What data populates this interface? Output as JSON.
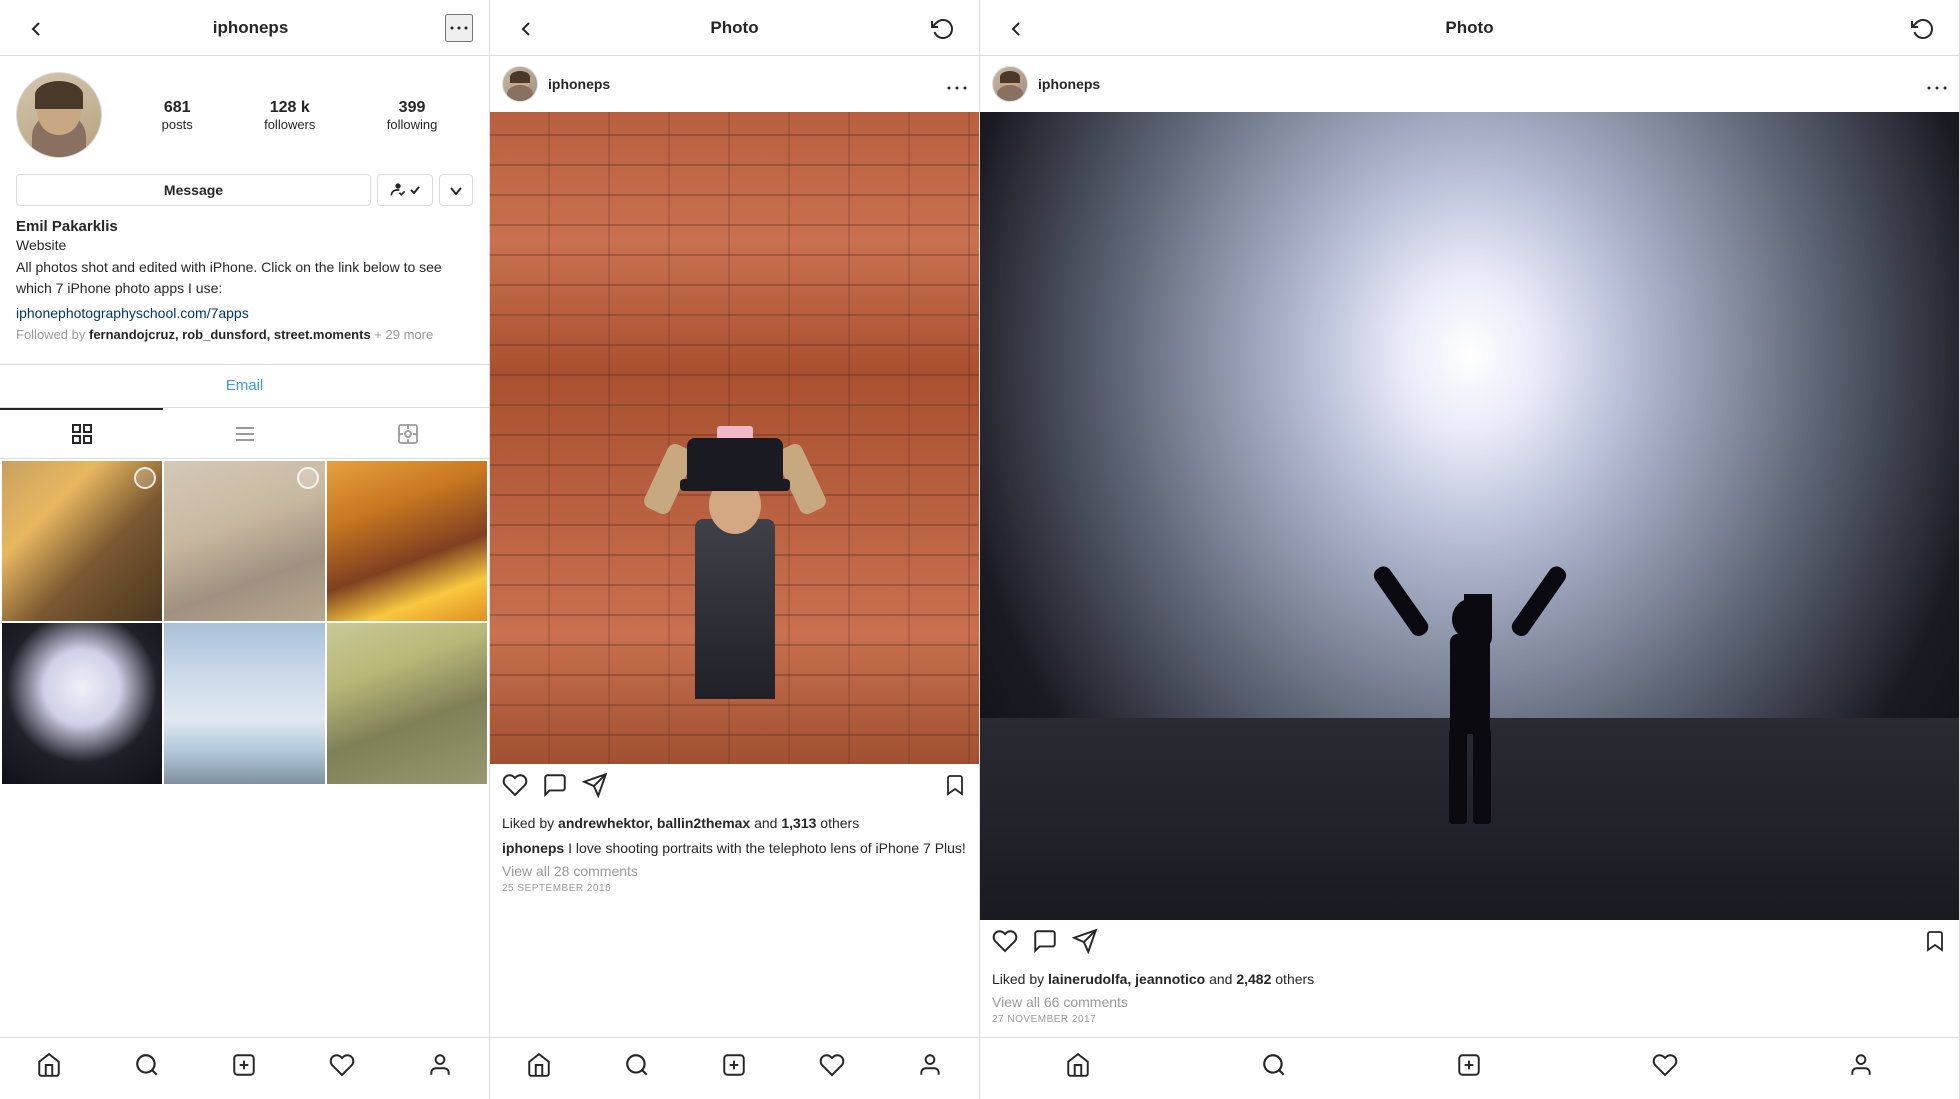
{
  "colors": {
    "accent": "#3897f0",
    "link": "#003569",
    "border": "#dbdbdb",
    "text_primary": "#262626",
    "text_secondary": "#999",
    "bg": "#fff"
  },
  "panel1": {
    "header": {
      "back_icon": "←",
      "title": "iphoneps",
      "more_icon": "···"
    },
    "profile": {
      "stats": {
        "posts_count": "681",
        "posts_label": "posts",
        "followers_count": "128 k",
        "followers_label": "followers",
        "following_count": "399",
        "following_label": "following"
      },
      "actions": {
        "message_label": "Message",
        "follow_check_icon": "✓",
        "dropdown_icon": "▾"
      },
      "name": "Emil Pakarklis",
      "website": "Website",
      "bio": "All photos shot and edited with iPhone. Click on the link below to see which 7 iPhone photo apps I use:",
      "link": "iphonephotographyschool.com/7apps",
      "followed_by_prefix": "Followed by ",
      "followed_by_users": "fernandojcruz, rob_dunsford, street.moments",
      "followed_by_suffix": " + 29 more",
      "email_label": "Email"
    },
    "tabs": {
      "grid_label": "Grid",
      "list_label": "List",
      "tagged_label": "Tagged"
    },
    "grid_photos": [
      {
        "id": 1,
        "class": "photo-1"
      },
      {
        "id": 2,
        "class": "photo-2"
      },
      {
        "id": 3,
        "class": "photo-3"
      },
      {
        "id": 4,
        "class": "photo-4"
      },
      {
        "id": 5,
        "class": "photo-5"
      },
      {
        "id": 6,
        "class": "photo-6"
      }
    ]
  },
  "panel2": {
    "header": {
      "back_icon": "←",
      "title": "Photo",
      "refresh_icon": "↺"
    },
    "post": {
      "username": "iphoneps",
      "more_icon": "···",
      "likes_text_before": "Liked by ",
      "likes_users": "andrewhektor, ballin2themax",
      "likes_text_after": " and ",
      "likes_count": "1,313",
      "likes_text_end": " others",
      "caption_username": "iphoneps",
      "caption_text": " I love shooting portraits with the telephoto lens of iPhone 7 Plus!",
      "view_comments": "View all 28 comments",
      "date": "25 September 2016"
    }
  },
  "panel3": {
    "header": {
      "back_icon": "←",
      "title": "Photo",
      "refresh_icon": "↺"
    },
    "post": {
      "username": "iphoneps",
      "more_icon": "···",
      "likes_text_before": "Liked by ",
      "likes_users": "lainerudolfa, jeannotico",
      "likes_text_after": " and ",
      "likes_count": "2,482",
      "likes_text_end": " others",
      "view_comments": "View all 66 comments",
      "date": "27 November 2017"
    }
  },
  "bottom_nav": {
    "home_icon": "home",
    "search_icon": "search",
    "add_icon": "add",
    "heart_icon": "heart",
    "profile_icon": "profile"
  }
}
